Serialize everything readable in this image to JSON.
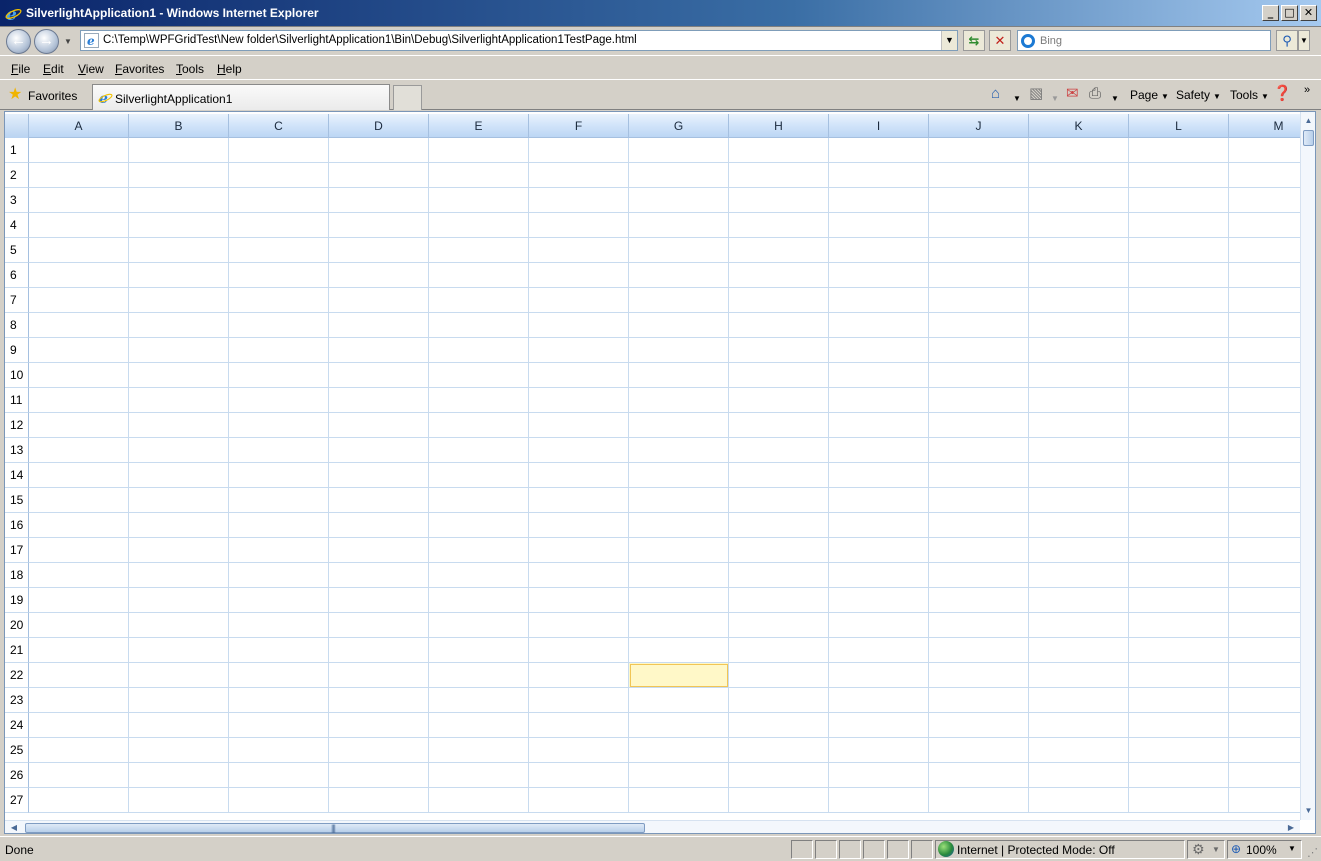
{
  "window": {
    "title": "SilverlightApplication1 - Windows Internet Explorer",
    "minimize_glyph": "_",
    "maximize_glyph": "□",
    "close_glyph": "✕"
  },
  "address_bar": {
    "url": "C:\\Temp\\WPFGridTest\\New folder\\SilverlightApplication1\\Bin\\Debug\\SilverlightApplication1TestPage.html"
  },
  "search": {
    "placeholder": "Bing"
  },
  "menu": [
    "File",
    "Edit",
    "View",
    "Favorites",
    "Tools",
    "Help"
  ],
  "favorites": {
    "label": "Favorites"
  },
  "tabs": [
    {
      "label": "SilverlightApplication1",
      "active": true
    }
  ],
  "command_bar": {
    "page": "Page",
    "safety": "Safety",
    "tools": "Tools"
  },
  "grid": {
    "columns": [
      "A",
      "B",
      "C",
      "D",
      "E",
      "F",
      "G",
      "H",
      "I",
      "J",
      "K",
      "L",
      "M"
    ],
    "rows": [
      "1",
      "2",
      "3",
      "4",
      "5",
      "6",
      "7",
      "8",
      "9",
      "10",
      "11",
      "12",
      "13",
      "14",
      "15",
      "16",
      "17",
      "18",
      "19",
      "20",
      "21",
      "22",
      "23",
      "24",
      "25",
      "26",
      "27"
    ],
    "selected_cell": {
      "column": "G",
      "row": "22"
    },
    "selection_color": "#fff8c8",
    "header_color": "#d3e5fa",
    "gridline_color": "#c8dbef"
  },
  "status_bar": {
    "text": "Done",
    "zone": "Internet | Protected Mode: Off",
    "zoom": "100%"
  },
  "icons": {
    "back": "back-arrow-icon",
    "forward": "forward-arrow-icon",
    "refresh": "refresh-icon",
    "stop": "stop-icon",
    "search_go": "magnifier-icon",
    "home": "home-icon",
    "feeds": "rss-icon",
    "mail": "mail-icon",
    "print": "printer-icon",
    "help": "help-icon"
  }
}
